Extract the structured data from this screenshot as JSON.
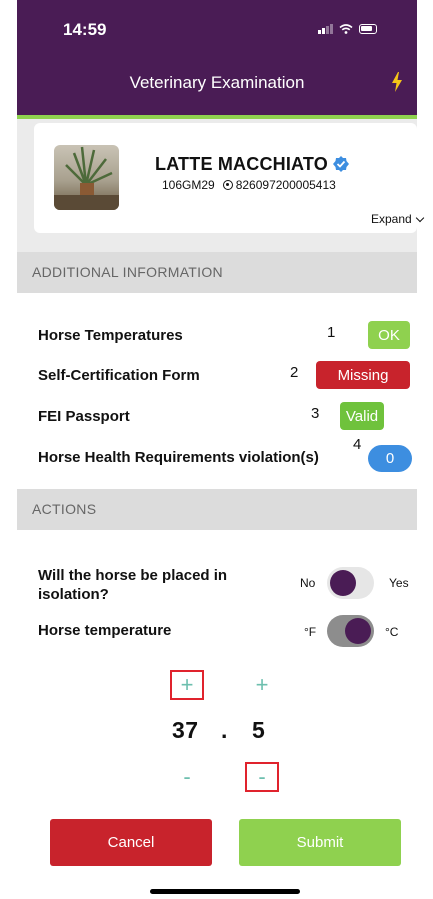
{
  "status_bar": {
    "time": "14:59"
  },
  "header": {
    "title": "Veterinary Examination"
  },
  "horse": {
    "name": "LATTE MACCHIATO",
    "code": "106GM29",
    "chip": "826097200005413",
    "expand_label": "Expand"
  },
  "additional_info": {
    "heading": "ADDITIONAL INFORMATION",
    "rows": [
      {
        "label": "Horse Temperatures",
        "num": "1",
        "badge": "OK"
      },
      {
        "label": "Self-Certification Form",
        "num": "2",
        "badge": "Missing"
      },
      {
        "label": "FEI Passport",
        "num": "3",
        "badge": "Valid"
      },
      {
        "label": "Horse Health Requirements violation(s)",
        "num": "4",
        "badge": "0"
      }
    ]
  },
  "actions": {
    "heading": "ACTIONS",
    "isolation_question": "Will the horse be placed in isolation?",
    "isolation_no": "No",
    "isolation_yes": "Yes",
    "temperature_label": "Horse temperature",
    "unit_f": "°F",
    "unit_c": "°C",
    "temp_integer": "37",
    "temp_separator": ".",
    "temp_decimal": "5",
    "plus_symbol": "+",
    "minus_symbol": "-",
    "cancel_label": "Cancel",
    "submit_label": "Submit"
  },
  "colors": {
    "header_bg": "#4a1c55",
    "accent": "#8fd14f",
    "ok": "#8fd14f",
    "missing": "#c8232c",
    "valid": "#6fc23c",
    "count": "#3d8ee0",
    "cancel": "#c8232c",
    "submit": "#8fd14f"
  }
}
